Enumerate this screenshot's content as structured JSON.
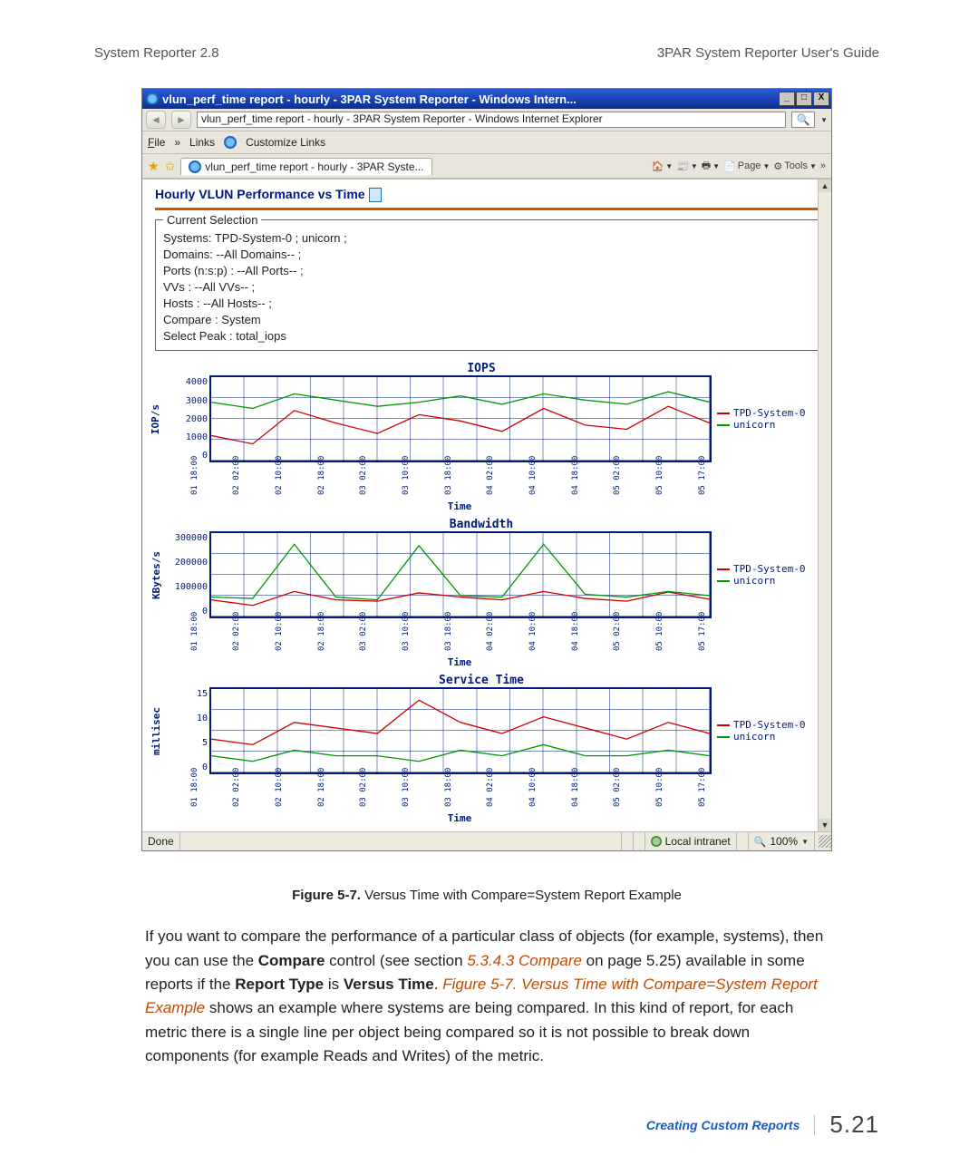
{
  "header": {
    "left": "System Reporter 2.8",
    "right": "3PAR System Reporter User's Guide"
  },
  "window": {
    "title": "vlun_perf_time report - hourly - 3PAR System Reporter - Windows Intern...",
    "address": "vlun_perf_time report - hourly - 3PAR System Reporter - Windows Internet Explorer",
    "menu": {
      "file": "File",
      "links_label": "Links",
      "customize": "Customize Links"
    },
    "tab": "vlun_perf_time report - hourly - 3PAR Syste...",
    "toolbar": {
      "page": "Page",
      "tools": "Tools"
    },
    "status": {
      "done": "Done",
      "zone": "Local intranet",
      "zoom": "100%"
    }
  },
  "report": {
    "title": "Hourly VLUN Performance vs Time",
    "selection_legend": "Current Selection",
    "selection": {
      "systems": "Systems: TPD-System-0 ; unicorn ;",
      "domains": "Domains: --All Domains-- ;",
      "ports": "Ports (n:s:p) : --All Ports-- ;",
      "vvs": "VVs : --All VVs-- ;",
      "hosts": "Hosts : --All Hosts-- ;",
      "compare": "Compare : System",
      "peak": "Select Peak : total_iops"
    },
    "legend_series": [
      "TPD-System-0",
      "unicorn"
    ],
    "xlabel": "Time",
    "categories": [
      "01 18:00",
      "02 02:00",
      "02 10:00",
      "02 18:00",
      "03 02:00",
      "03 10:00",
      "03 18:00",
      "04 02:00",
      "04 10:00",
      "04 18:00",
      "05 02:00",
      "05 10:00",
      "05 17:00"
    ]
  },
  "chart_data": [
    {
      "type": "line",
      "title": "IOPS",
      "ylabel": "IOP/s",
      "xlabel": "Time",
      "ylim": [
        0,
        4000
      ],
      "yticks": [
        0,
        1000,
        2000,
        3000,
        4000
      ],
      "categories": [
        "01 18:00",
        "02 02:00",
        "02 10:00",
        "02 18:00",
        "03 02:00",
        "03 10:00",
        "03 18:00",
        "04 02:00",
        "04 10:00",
        "04 18:00",
        "05 02:00",
        "05 10:00",
        "05 17:00"
      ],
      "series": [
        {
          "name": "TPD-System-0",
          "color": "#cc0000",
          "values": [
            1200,
            800,
            2400,
            1800,
            1300,
            2200,
            1900,
            1400,
            2500,
            1700,
            1500,
            2600,
            1800
          ]
        },
        {
          "name": "unicorn",
          "color": "#009900",
          "values": [
            2800,
            2500,
            3200,
            2900,
            2600,
            2800,
            3100,
            2700,
            3200,
            2900,
            2700,
            3300,
            2800
          ]
        }
      ]
    },
    {
      "type": "line",
      "title": "Bandwidth",
      "ylabel": "KBytes/s",
      "xlabel": "Time",
      "ylim": [
        0,
        300000
      ],
      "yticks": [
        0,
        100000,
        200000,
        300000
      ],
      "categories": [
        "01 18:00",
        "02 02:00",
        "02 10:00",
        "02 18:00",
        "03 02:00",
        "03 10:00",
        "03 18:00",
        "04 02:00",
        "04 10:00",
        "04 18:00",
        "05 02:00",
        "05 10:00",
        "05 17:00"
      ],
      "series": [
        {
          "name": "TPD-System-0",
          "color": "#cc0000",
          "values": [
            60000,
            40000,
            90000,
            60000,
            55000,
            85000,
            70000,
            60000,
            90000,
            65000,
            55000,
            88000,
            62000
          ]
        },
        {
          "name": "unicorn",
          "color": "#009900",
          "values": [
            70000,
            65000,
            260000,
            70000,
            60000,
            255000,
            75000,
            70000,
            260000,
            80000,
            70000,
            90000,
            75000
          ]
        }
      ]
    },
    {
      "type": "line",
      "title": "Service Time",
      "ylabel": "millisec",
      "xlabel": "Time",
      "ylim": [
        0,
        15
      ],
      "yticks": [
        0,
        5,
        10,
        15
      ],
      "categories": [
        "01 18:00",
        "02 02:00",
        "02 10:00",
        "02 18:00",
        "03 02:00",
        "03 10:00",
        "03 18:00",
        "04 02:00",
        "04 10:00",
        "04 18:00",
        "05 02:00",
        "05 10:00",
        "05 17:00"
      ],
      "series": [
        {
          "name": "TPD-System-0",
          "color": "#cc0000",
          "values": [
            6,
            5,
            9,
            8,
            7,
            13,
            9,
            7,
            10,
            8,
            6,
            9,
            7
          ]
        },
        {
          "name": "unicorn",
          "color": "#009900",
          "values": [
            3,
            2,
            4,
            3,
            3,
            2,
            4,
            3,
            5,
            3,
            3,
            4,
            3
          ]
        }
      ]
    }
  ],
  "caption": {
    "label": "Figure 5-7.",
    "text": "Versus Time with Compare=System Report Example"
  },
  "body": {
    "p1a": "If you want to compare the performance of a particular class of objects (for example, systems), then you can use the ",
    "b1": "Compare",
    "p1b": " control (see section ",
    "r1": "5.3.4.3 Compare",
    "p1c": " on page 5.25) available in some reports if the ",
    "b2": "Report Type",
    "p1d": " is ",
    "b3": "Versus Time",
    "p1e": ". ",
    "r2": "Figure 5-7. Versus Time with Compare=System Report Example",
    "p1f": " shows an example where systems are being compared. In this kind of report, for each metric there is a single line per object being compared so it is not possible to break down components (for example Reads and Writes) of the metric."
  },
  "footer": {
    "section": "Creating Custom Reports",
    "page": "5.21"
  }
}
